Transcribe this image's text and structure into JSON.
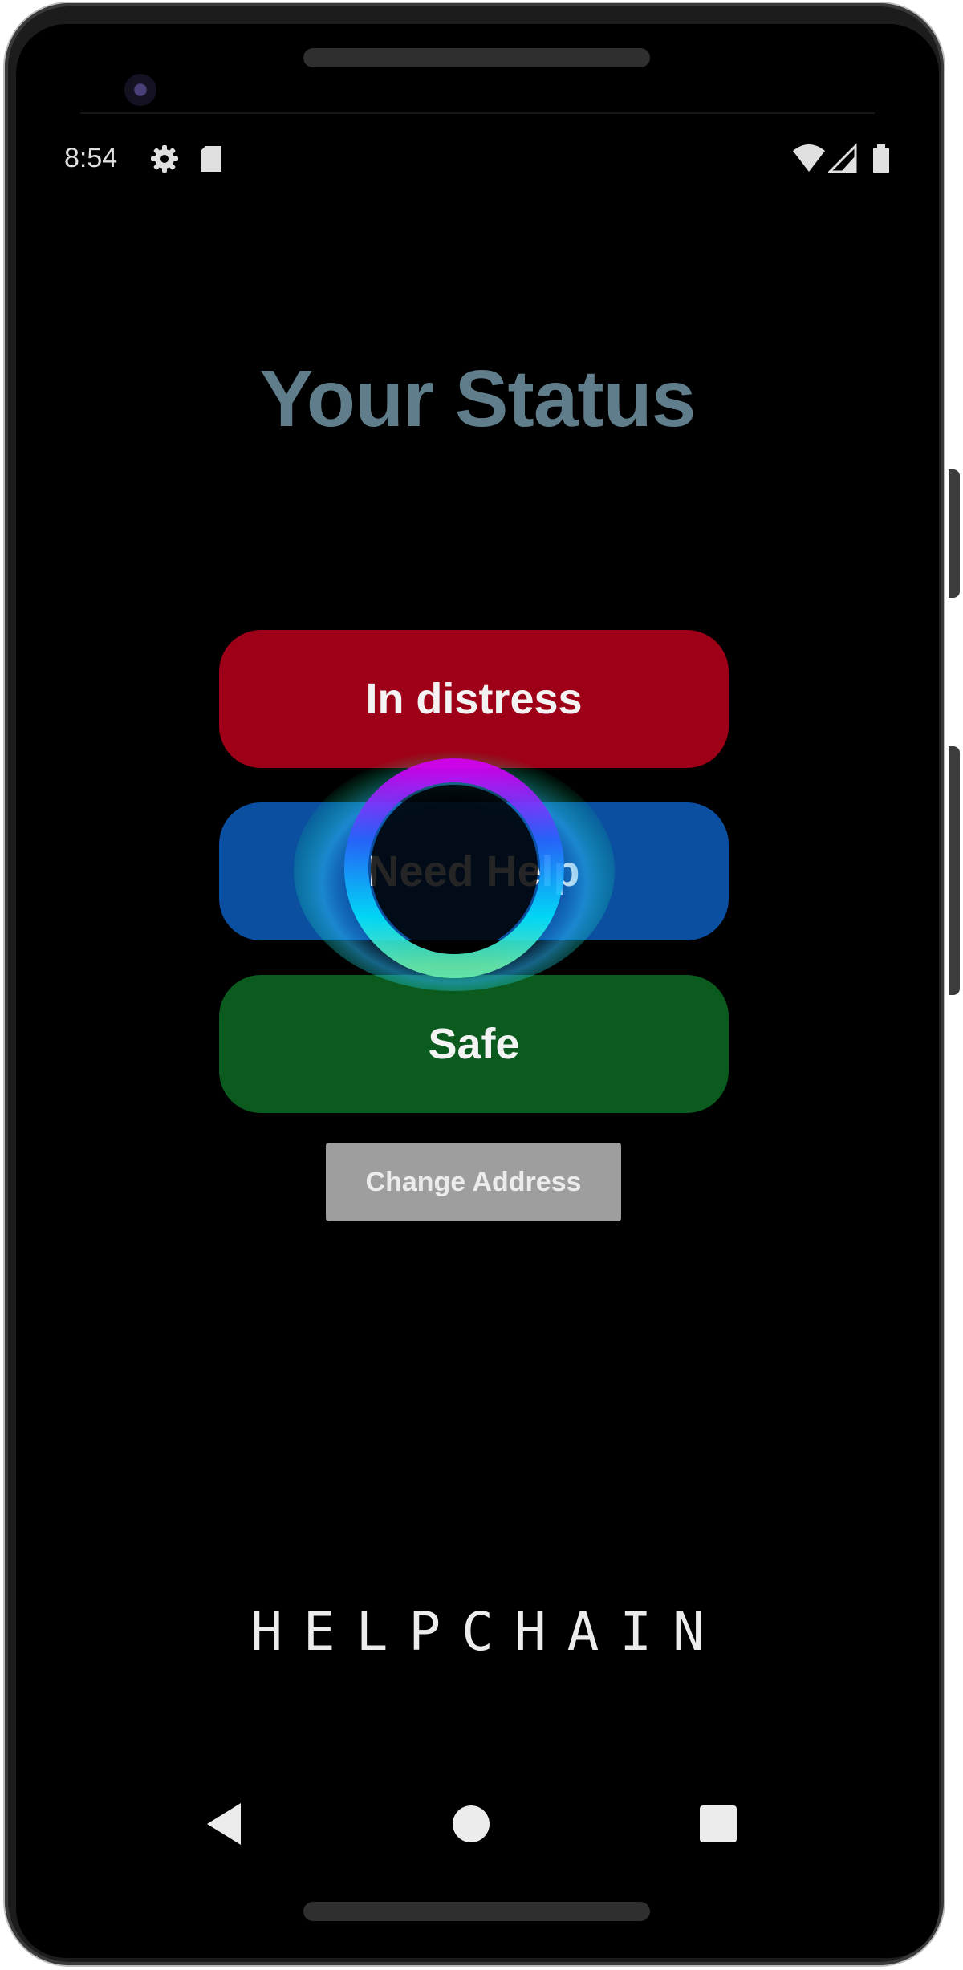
{
  "status_bar": {
    "time": "8:54",
    "icons": [
      "gear-icon",
      "sd-card-icon",
      "wifi-icon",
      "signal-icon",
      "battery-icon"
    ]
  },
  "screen": {
    "title": "Your Status",
    "buttons": {
      "distress": "In distress",
      "need_help": "Need Help",
      "safe": "Safe",
      "change_address": "Change Address"
    },
    "brand": "HELPCHAIN"
  },
  "nav": {
    "icons": [
      "back-icon",
      "home-icon",
      "recents-icon"
    ]
  },
  "colors": {
    "title": "#607d8b",
    "distress": "#9e0017",
    "need_help": "#0a4fa0",
    "safe": "#0b5a1e",
    "change_address": "#9e9e9e",
    "background": "#000000"
  }
}
